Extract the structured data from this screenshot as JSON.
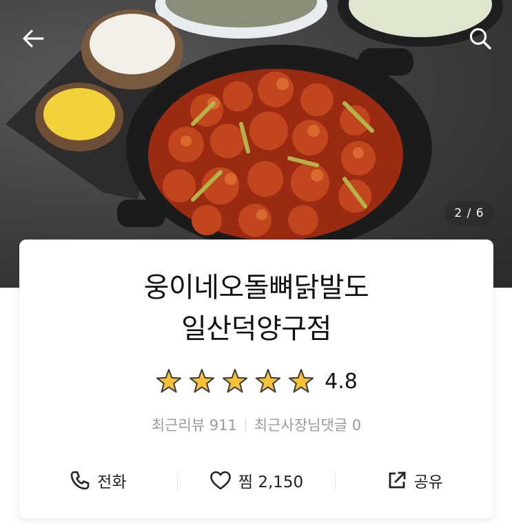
{
  "header": {
    "back_icon": "arrow-left-icon",
    "search_icon": "search-icon",
    "image_counter": "2 / 6"
  },
  "store": {
    "name_line1": "웅이네오돌뼈닭발도",
    "name_line2": "일산덕양구점",
    "rating": 4.8,
    "rating_text": "4.8",
    "star_count": 5,
    "star_color": "#f5c23a",
    "recent_reviews": "최근리뷰 911",
    "owner_comments": "최근사장님댓글 0"
  },
  "actions": {
    "call_label": "전화",
    "call_icon": "phone-icon",
    "like_label": "찜 2,150",
    "like_icon": "heart-outline-icon",
    "share_label": "공유",
    "share_icon": "share-icon"
  }
}
